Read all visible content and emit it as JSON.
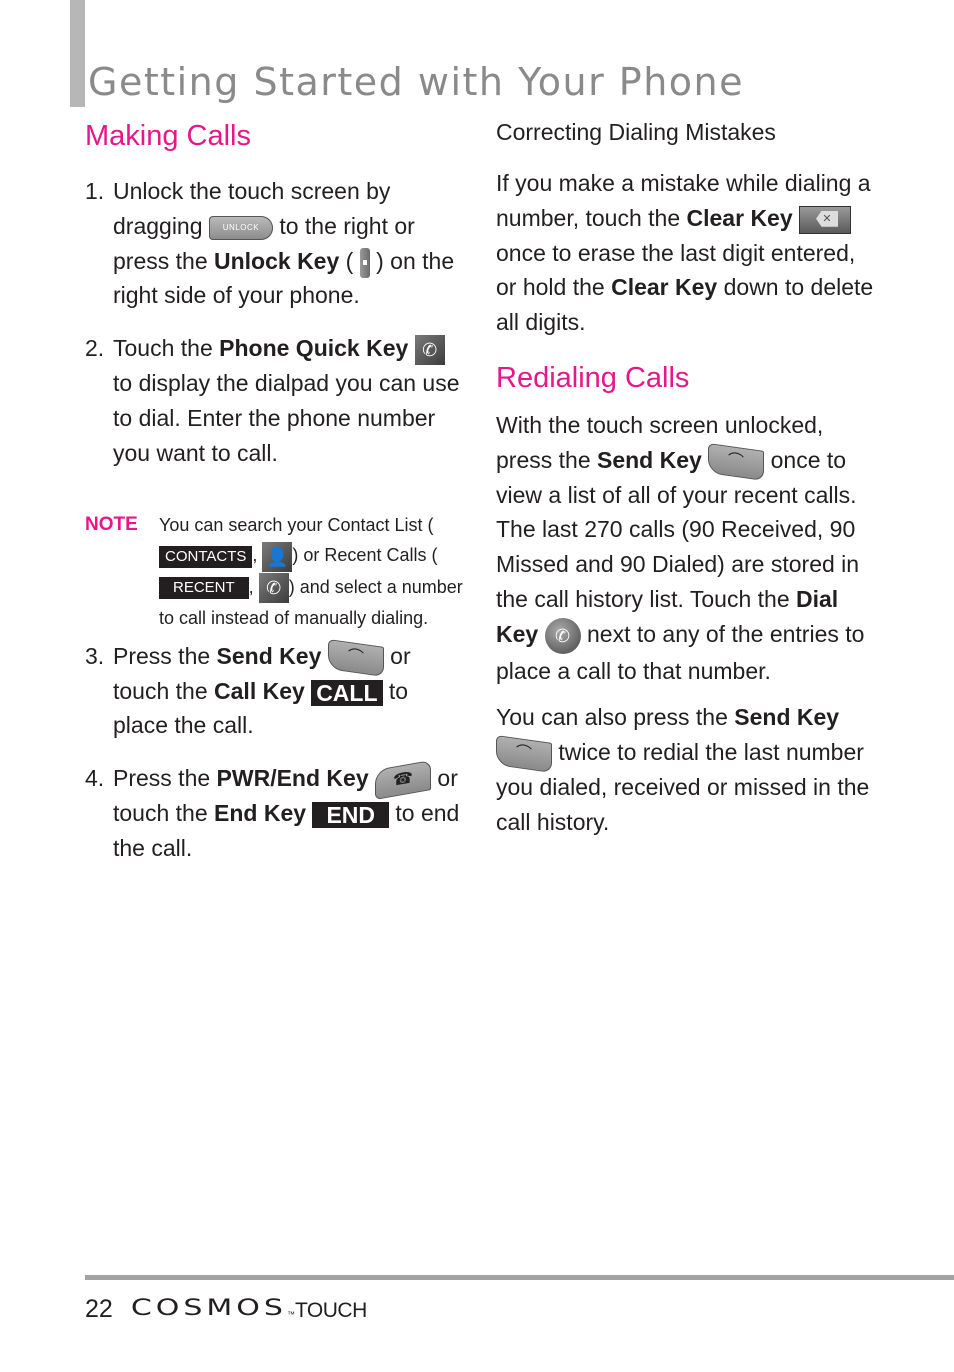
{
  "header": {
    "title": "Getting Started with Your Phone"
  },
  "left": {
    "heading": "Making Calls",
    "steps": [
      {
        "num": "1.",
        "parts": [
          "Unlock the touch screen by dragging",
          "to the right or press the",
          "Unlock Key",
          "(",
          ") on the right side of your phone."
        ],
        "icon_unlock_slider": "UNLOCK"
      },
      {
        "num": "2.",
        "parts": [
          "Touch the",
          "Phone Quick Key",
          "to display the dialpad you can use to dial. Enter the phone number you want to call."
        ]
      },
      {
        "num": "3.",
        "parts": [
          "Press the",
          "Send Key",
          "or touch the",
          "Call Key",
          "to place the call."
        ],
        "call_tag": "CALL"
      },
      {
        "num": "4.",
        "parts": [
          "Press the",
          "PWR/End Key",
          "or touch the",
          "End Key",
          "to end the call."
        ],
        "end_tag": "END"
      }
    ],
    "note": {
      "label": "NOTE",
      "parts": [
        "You can search your Contact List (",
        ",",
        ") or Recent Calls (",
        ",",
        ") and select a number to call instead of manually dialing."
      ],
      "contacts_tag": "CONTACTS",
      "recent_tag": "RECENT"
    }
  },
  "right": {
    "subheading": "Correcting Dialing Mistakes",
    "correcting": [
      "If you make a mistake while dialing a number, touch the",
      "Clear Key",
      "once to erase the last digit entered, or hold the",
      "Clear Key",
      "down to delete all digits."
    ],
    "heading": "Redialing Calls",
    "para1": [
      "With the touch screen unlocked, press the",
      "Send Key",
      "once to view a list of all of your recent calls. The last 270 calls (90 Received, 90 Missed and 90 Dialed) are stored in the call history list. Touch the",
      "Dial Key",
      "next to any of the entries to place a call to that number."
    ],
    "para2": [
      "You can also press the",
      "Send Key",
      "twice to redial the last number you dialed, received or missed in the call history."
    ]
  },
  "footer": {
    "page_number": "22",
    "brand": "COSMOS",
    "trademark": "™",
    "brand_sub": "TOUCH"
  },
  "colors": {
    "accent": "#e6178b",
    "title_gray": "#8a8a8a",
    "rule_gray": "#a3a3a3"
  }
}
